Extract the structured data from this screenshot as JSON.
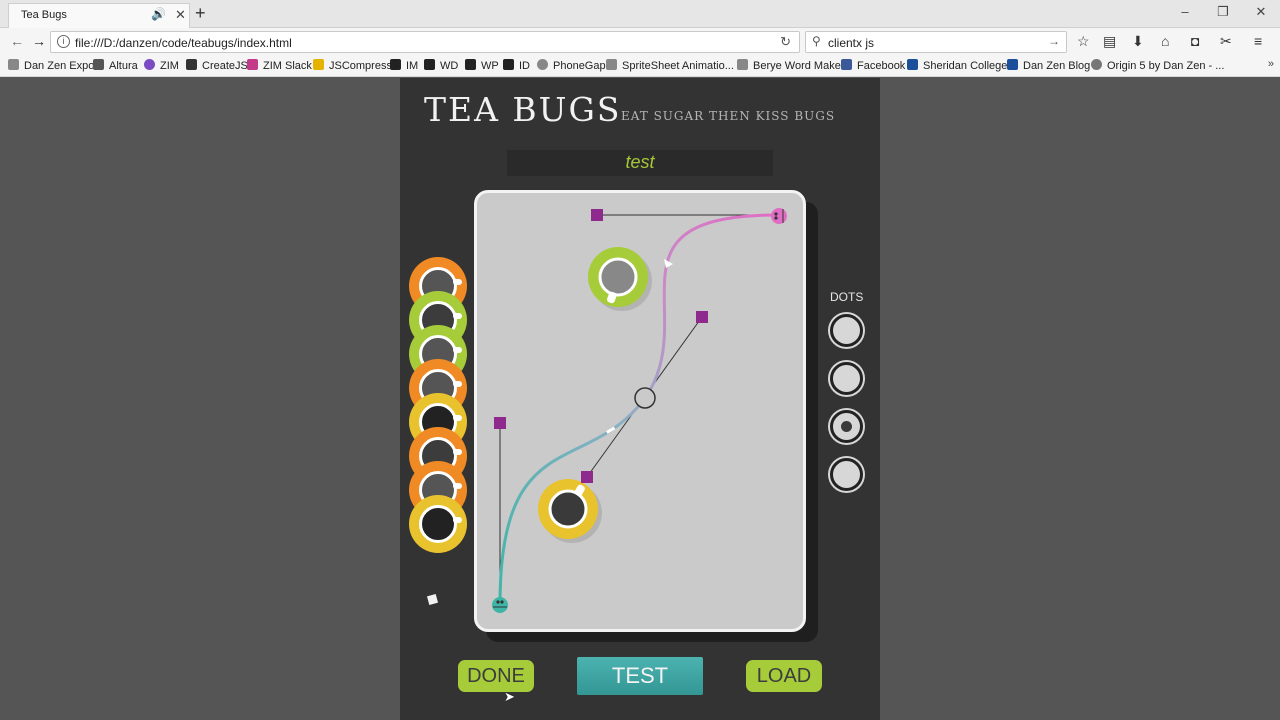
{
  "browser": {
    "tab_title": "Tea Bugs",
    "url": "file:///D:/danzen/code/teabugs/index.html",
    "search_value": "clientx js",
    "bookmarks": [
      "Dan Zen Expo",
      "Altura",
      "ZIM",
      "CreateJS",
      "ZIM Slack",
      "JSCompress",
      "IM",
      "WD",
      "WP",
      "ID",
      "PhoneGap",
      "SpriteSheet Animatio...",
      "Berye Word Maker",
      "Facebook",
      "Sheridan College",
      "Dan Zen Blog",
      "Origin 5 by Dan Zen - ..."
    ],
    "bookmark_more": "»"
  },
  "game": {
    "title": "TEA BUGS",
    "subtitle": "EAT SUGAR THEN KISS BUGS",
    "level_name": "test",
    "dots_label": "DOTS",
    "dots_selected_index": 2,
    "buttons": {
      "done": "DONE",
      "test": "TEST",
      "load": "LOAD"
    },
    "stack_cups": [
      {
        "rim": "#f08a24",
        "tea": "#555555"
      },
      {
        "rim": "#a6cc3a",
        "tea": "#3c3c3c"
      },
      {
        "rim": "#a6cc3a",
        "tea": "#555555"
      },
      {
        "rim": "#f08a24",
        "tea": "#555555"
      },
      {
        "rim": "#e8c32e",
        "tea": "#222222"
      },
      {
        "rim": "#f08a24",
        "tea": "#3c3c3c"
      },
      {
        "rim": "#f08a24",
        "tea": "#555555"
      },
      {
        "rim": "#e8c32e",
        "tea": "#222222"
      }
    ],
    "colors": {
      "green": "#a6cc3a",
      "orange": "#f08a24",
      "yellow": "#e8c32e",
      "teal": "#3fa8a6",
      "pink": "#e06cc4",
      "handle": "#8e2a8e"
    }
  }
}
